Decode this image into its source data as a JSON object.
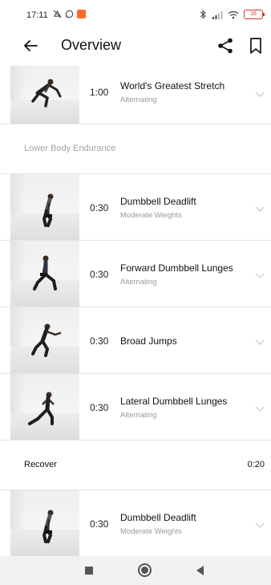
{
  "status": {
    "time": "17:11",
    "battery": "16"
  },
  "header": {
    "title": "Overview"
  },
  "rows": [
    {
      "duration": "1:00",
      "title": "World's Greatest Stretch",
      "subtitle": "Alternating"
    },
    {
      "section": "Lower Body Endurance"
    },
    {
      "duration": "0:30",
      "title": "Dumbbell Deadlift",
      "subtitle": "Moderate Weights"
    },
    {
      "duration": "0:30",
      "title": "Forward Dumbbell Lunges",
      "subtitle": "Alternating"
    },
    {
      "duration": "0:30",
      "title": "Broad Jumps",
      "subtitle": ""
    },
    {
      "duration": "0:30",
      "title": "Lateral Dumbbell Lunges",
      "subtitle": "Alternating"
    },
    {
      "recover_label": "Recover",
      "recover_time": "0:20"
    },
    {
      "duration": "0:30",
      "title": "Dumbbell Deadlift",
      "subtitle": "Moderate Weights"
    }
  ],
  "icons": {
    "back": "arrow-left-icon",
    "share": "share-icon",
    "bookmark": "bookmark-icon",
    "expand": "chevron-down-icon"
  },
  "colors": {
    "divider": "#e5e5e5",
    "subtitle": "#9a9a9a",
    "notification_badge": "#ff6a2b",
    "battery_low": "#d93025"
  }
}
